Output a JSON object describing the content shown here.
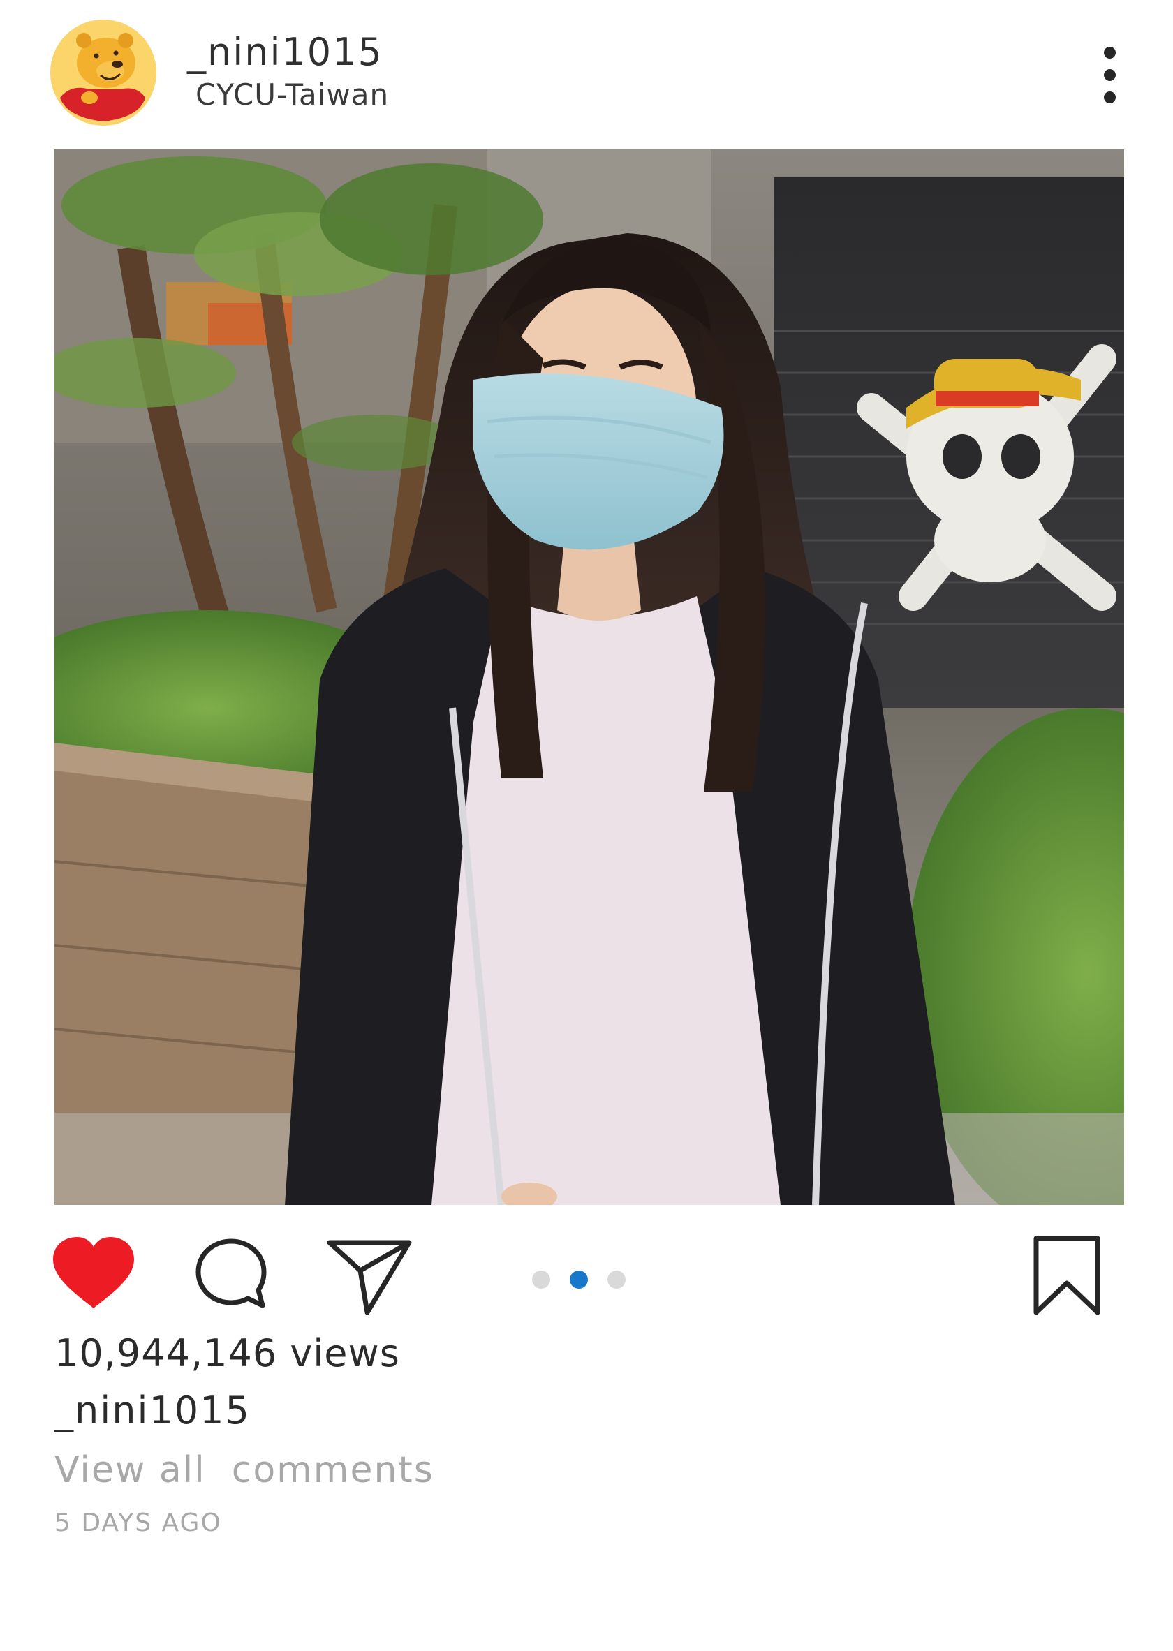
{
  "header": {
    "username": "_nini1015",
    "location": "CYCU-Taiwan",
    "avatar_icon": "winnie-the-pooh-avatar",
    "more_icon": "more-options-icon"
  },
  "post": {
    "image_icon": "post-photo",
    "carousel": {
      "count": 3,
      "active_index": 1,
      "active_color": "#1777cb",
      "inactive_color": "#d9d9d9"
    }
  },
  "actions": {
    "like_icon": "heart-icon",
    "like_active": true,
    "like_color": "#ed1c24",
    "comment_icon": "comment-icon",
    "share_icon": "share-icon",
    "save_icon": "bookmark-icon"
  },
  "stats": {
    "views": "10,944,146 views"
  },
  "caption": {
    "username": "_nini1015"
  },
  "comments": {
    "view_all": "View all  comments"
  },
  "meta": {
    "timestamp": "5 DAYS AGO"
  }
}
